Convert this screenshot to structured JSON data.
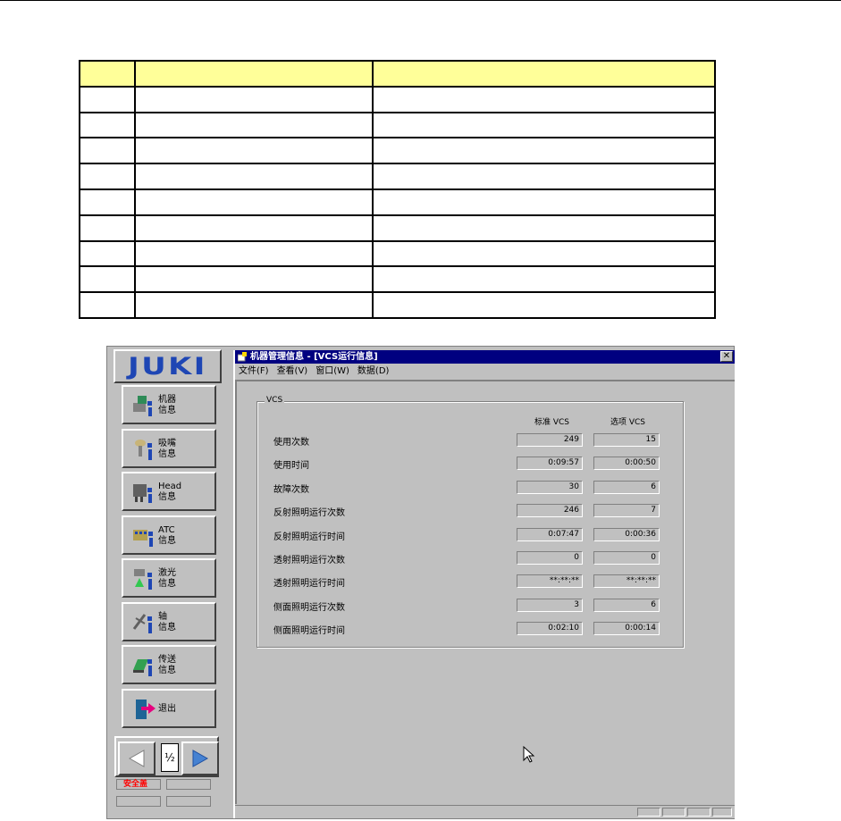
{
  "app": {
    "logo_text": "JUKI",
    "nav_buttons": [
      {
        "label": "机器\n信息",
        "icon": "machine-info-icon"
      },
      {
        "label": "吸嘴\n信息",
        "icon": "nozzle-info-icon"
      },
      {
        "label": "Head\n信息",
        "icon": "head-info-icon"
      },
      {
        "label": "ATC\n信息",
        "icon": "atc-info-icon"
      },
      {
        "label": "激光\n信息",
        "icon": "laser-info-icon"
      },
      {
        "label": "轴\n信息",
        "icon": "axis-info-icon"
      },
      {
        "label": "传送\n信息",
        "icon": "conveyor-info-icon"
      },
      {
        "label": "退出",
        "icon": "exit-icon"
      }
    ],
    "pager": {
      "indicator": "½"
    },
    "status": {
      "safety_label": "安全盖"
    }
  },
  "window": {
    "title": "机器管理信息 - [VCS运行信息]",
    "close_glyph": "✕",
    "menu": [
      "文件(F)",
      "查看(V)",
      "窗口(W)",
      "数据(D)"
    ],
    "group_label": "VCS",
    "col_standard": "标准 VCS",
    "col_option": "选项 VCS",
    "rows": [
      {
        "label": "使用次数",
        "standard": "249",
        "option": "15"
      },
      {
        "label": "使用时间",
        "standard": "0:09:57",
        "option": "0:00:50"
      },
      {
        "label": "故障次数",
        "standard": "30",
        "option": "6"
      },
      {
        "label": "反射照明运行次数",
        "standard": "246",
        "option": "7"
      },
      {
        "label": "反射照明运行时间",
        "standard": "0:07:47",
        "option": "0:00:36"
      },
      {
        "label": "透射照明运行次数",
        "standard": "0",
        "option": "0"
      },
      {
        "label": "透射照明运行时间",
        "standard": "**:**:**",
        "option": "**:**:**"
      },
      {
        "label": "侧面照明运行次数",
        "standard": "3",
        "option": "6"
      },
      {
        "label": "侧面照明运行时间",
        "standard": "0:02:10",
        "option": "0:00:14"
      }
    ]
  },
  "colors": {
    "title_bar": "#000080",
    "logo": "#1e46b4",
    "table_header": "#ffff99",
    "pager_arrow": "#4682d2"
  }
}
